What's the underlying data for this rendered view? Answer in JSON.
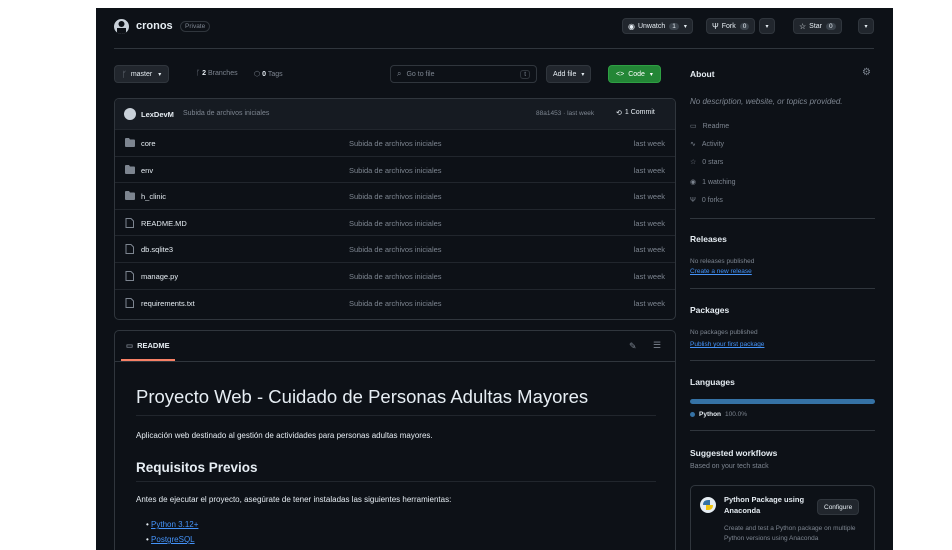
{
  "repo": {
    "name": "cronos",
    "visibility": "Private"
  },
  "actions": {
    "unwatch_label": "Unwatch",
    "unwatch_count": "1",
    "fork_label": "Fork",
    "fork_count": "0",
    "star_label": "Star",
    "star_count": "0"
  },
  "toolbar": {
    "branch": "master",
    "branches_count": "2",
    "branches_label": "Branches",
    "tags_count": "0",
    "tags_label": "Tags",
    "goto_placeholder": "Go to file",
    "goto_key": "t",
    "add_file_label": "Add file",
    "code_label": "Code"
  },
  "commit": {
    "author": "LexDevM",
    "message": "Subida de archivos iniciales",
    "hash_time": "88a1453 · last week",
    "commits_label": "1 Commit"
  },
  "files": [
    {
      "name": "core",
      "type": "folder",
      "message": "Subida de archivos iniciales",
      "time": "last week"
    },
    {
      "name": "env",
      "type": "folder",
      "message": "Subida de archivos iniciales",
      "time": "last week"
    },
    {
      "name": "h_clinic",
      "type": "folder",
      "message": "Subida de archivos iniciales",
      "time": "last week"
    },
    {
      "name": "README.MD",
      "type": "file",
      "message": "Subida de archivos iniciales",
      "time": "last week"
    },
    {
      "name": "db.sqlite3",
      "type": "file",
      "message": "Subida de archivos iniciales",
      "time": "last week"
    },
    {
      "name": "manage.py",
      "type": "file",
      "message": "Subida de archivos iniciales",
      "time": "last week"
    },
    {
      "name": "requirements.txt",
      "type": "file",
      "message": "Subida de archivos iniciales",
      "time": "last week"
    }
  ],
  "readme": {
    "tab_label": "README",
    "title": "Proyecto Web - Cuidado de Personas Adultas Mayores",
    "description": "Aplicación web destinado al gestión de actividades para personas adultas mayores.",
    "section_title": "Requisitos Previos",
    "section_text": "Antes de ejecutar el proyecto, asegúrate de tener instaladas las siguientes herramientas:",
    "requirements": [
      "Python 3.12+",
      "PostgreSQL"
    ]
  },
  "about": {
    "title": "About",
    "description": "No description, website, or topics provided.",
    "readme": "Readme",
    "activity": "Activity",
    "stars": "0 stars",
    "watching": "1 watching",
    "forks": "0 forks"
  },
  "releases": {
    "title": "Releases",
    "text": "No releases published",
    "link": "Create a new release"
  },
  "packages": {
    "title": "Packages",
    "text": "No packages published",
    "link": "Publish your first package"
  },
  "languages": {
    "title": "Languages",
    "items": [
      {
        "name": "Python",
        "percent": "100.0%",
        "color": "#3572A5",
        "fraction": 1.0
      }
    ]
  },
  "workflows": {
    "title": "Suggested workflows",
    "subtitle": "Based on your tech stack",
    "card_title": "Python Package using Anaconda",
    "card_desc": "Create and test a Python package on multiple Python versions using Anaconda",
    "configure_label": "Configure"
  },
  "colors": {
    "background": "#0d1117",
    "border": "#30363d",
    "accent": "#4493f8",
    "green": "#238636",
    "muted": "#7d8590"
  }
}
